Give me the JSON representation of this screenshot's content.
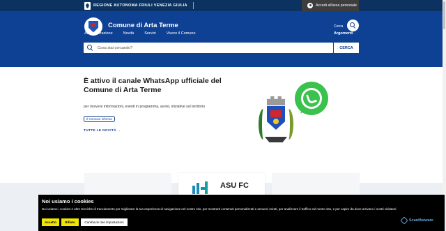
{
  "topbar": {
    "region_name": "REGIONE AUTONOMA FRIULI VENEZIA GIULIA",
    "login_label": "Accedi all'area personale",
    "bg_color": "#0b3260"
  },
  "header": {
    "site_title": "Comune di Arta Terme",
    "search_label": "Cerca",
    "bg_color": "#0e4194"
  },
  "nav": {
    "items": [
      {
        "label": "Amministrazione"
      },
      {
        "label": "Novità"
      },
      {
        "label": "Servizi"
      },
      {
        "label": "Vivere il Comune"
      }
    ],
    "right_label": "Argomenti"
  },
  "search": {
    "placeholder": "Cosa stai cercando?",
    "button_label": "CERCA"
  },
  "hero": {
    "title": "È attivo il canale WhatsApp ufficiale del Comune di Arta Terme",
    "subtitle": "per ricevere informazioni, eventi in programma, avvisi, iniziative sul territorio",
    "chip": "Il Comune informa",
    "all_news": "TUTTE LE NOVITÀ"
  },
  "cards": {
    "asu_label": "ASU FC"
  },
  "cookie": {
    "title": "Noi usiamo i cookies",
    "text": "Noi usiamo i cookies e altre tecniche di tracciamento per migliorare la tua esperienza di navigazione nel nostro sito, per mostrarti contenuti personalizzati e annunci mirati, per analizzare il traffico sul nostro sito, e per capire da dove arrivano i nostri visitatori.",
    "accept_label": "Accetto",
    "reject_label": "Rifiuto",
    "settings_label": "Cambia le mie impostazioni",
    "brand": "ScanMalware",
    "button_color": "#f2e600"
  },
  "icons": {
    "search": "search-icon",
    "user": "user-icon",
    "whatsapp": "whatsapp-icon",
    "arrow": "arrow-right-icon"
  }
}
